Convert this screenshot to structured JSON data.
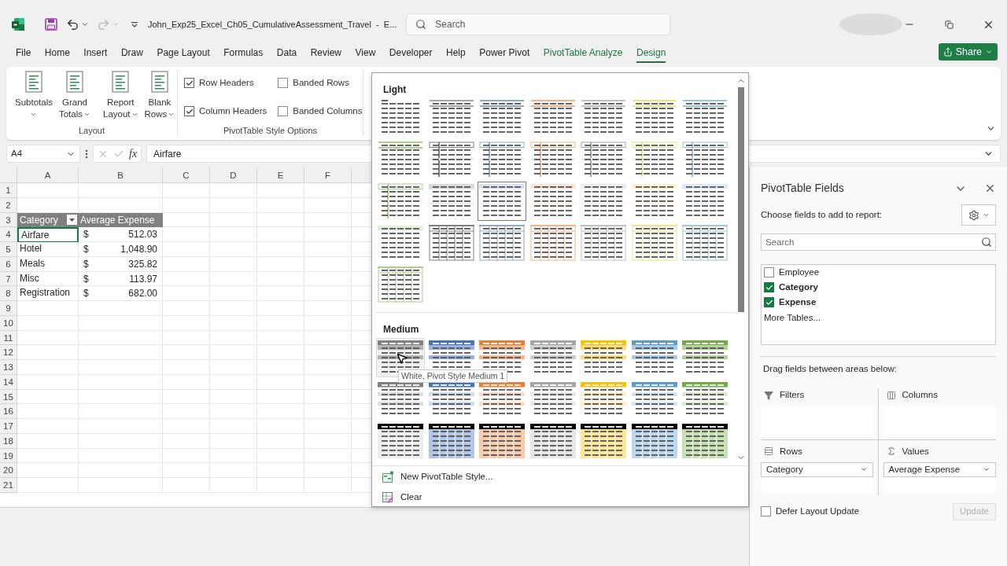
{
  "title_bar": {
    "title": "John_Exp25_Excel_Ch05_CumulativeAssessment_Travel  -  E...",
    "search": {
      "placeholder": "Search"
    },
    "share": "Share"
  },
  "menu_tabs": [
    {
      "label": "File",
      "contextual": false,
      "selected": false
    },
    {
      "label": "Home",
      "contextual": false,
      "selected": false
    },
    {
      "label": "Insert",
      "contextual": false,
      "selected": false
    },
    {
      "label": "Draw",
      "contextual": false,
      "selected": false
    },
    {
      "label": "Page Layout",
      "contextual": false,
      "selected": false
    },
    {
      "label": "Formulas",
      "contextual": false,
      "selected": false
    },
    {
      "label": "Data",
      "contextual": false,
      "selected": false
    },
    {
      "label": "Review",
      "contextual": false,
      "selected": false
    },
    {
      "label": "View",
      "contextual": false,
      "selected": false
    },
    {
      "label": "Developer",
      "contextual": false,
      "selected": false
    },
    {
      "label": "Help",
      "contextual": false,
      "selected": false
    },
    {
      "label": "Power Pivot",
      "contextual": false,
      "selected": false
    },
    {
      "label": "PivotTable Analyze",
      "contextual": true,
      "selected": false
    },
    {
      "label": "Design",
      "contextual": true,
      "selected": true
    }
  ],
  "ribbon": {
    "layout_group": {
      "label": "Layout",
      "buttons": [
        {
          "lines": [
            "Subtotals"
          ]
        },
        {
          "lines": [
            "Grand",
            "Totals"
          ]
        },
        {
          "lines": [
            "Report",
            "Layout"
          ]
        },
        {
          "lines": [
            "Blank",
            "Rows"
          ]
        }
      ]
    },
    "options_group": {
      "label": "PivotTable Style Options",
      "checkboxes": [
        {
          "label": "Row Headers",
          "checked": true
        },
        {
          "label": "Column Headers",
          "checked": true
        },
        {
          "label": "Banded Rows",
          "checked": false
        },
        {
          "label": "Banded Columns",
          "checked": false
        }
      ]
    }
  },
  "formula_bar": {
    "name_box": "A4",
    "fx": "fx",
    "value": "Airfare"
  },
  "sheet": {
    "columns": [
      "A",
      "B",
      "C",
      "D",
      "E",
      "F"
    ],
    "row_numbers": [
      "1",
      "2",
      "3",
      "4",
      "5",
      "6",
      "7",
      "8",
      "9",
      "10",
      "11",
      "12",
      "13",
      "14",
      "15",
      "16",
      "17",
      "18",
      "19",
      "20",
      "21"
    ],
    "pivot": {
      "header": [
        "Category",
        "Average Expense"
      ],
      "rows": [
        {
          "label": "Airfare",
          "currency": "$",
          "value": "512.03",
          "selected": true
        },
        {
          "label": "Hotel",
          "currency": "$",
          "value": "1,048.90",
          "selected": false
        },
        {
          "label": "Meals",
          "currency": "$",
          "value": "325.82",
          "selected": false
        },
        {
          "label": "Misc",
          "currency": "$",
          "value": "113.97",
          "selected": false
        },
        {
          "label": "Registration",
          "currency": "$",
          "value": "682.00",
          "selected": false
        }
      ]
    }
  },
  "style_gallery": {
    "sections": [
      {
        "title": "Light",
        "styles": [
          {
            "kind": "plain",
            "color": "#595959",
            "selected": false,
            "hovered": false
          },
          {
            "kind": "lines",
            "color": "#a6a6a6",
            "selected": false,
            "hovered": false
          },
          {
            "kind": "lines",
            "color": "#8ea9c1",
            "selected": false,
            "hovered": false
          },
          {
            "kind": "lines",
            "color": "#f4b183",
            "selected": false,
            "hovered": false
          },
          {
            "kind": "lines",
            "color": "#bfbfbf",
            "selected": false,
            "hovered": false
          },
          {
            "kind": "lines",
            "color": "#e6e67a",
            "selected": false,
            "hovered": false
          },
          {
            "kind": "lines",
            "color": "#9dc3d4",
            "selected": false,
            "hovered": false
          },
          {
            "kind": "lines",
            "color": "#a9d08e",
            "selected": false,
            "hovered": false
          },
          {
            "kind": "outline",
            "color": "#808080",
            "selected": false,
            "hovered": false
          },
          {
            "kind": "outline",
            "color": "#8ea9c1",
            "selected": false,
            "hovered": false
          },
          {
            "kind": "outline",
            "color": "#f4b183",
            "selected": false,
            "hovered": false
          },
          {
            "kind": "outline",
            "color": "#a6a6a6",
            "selected": false,
            "hovered": false
          },
          {
            "kind": "outline",
            "color": "#e6e67a",
            "selected": false,
            "hovered": false
          },
          {
            "kind": "outline",
            "color": "#9dc3d4",
            "selected": false,
            "hovered": false
          },
          {
            "kind": "outline",
            "color": "#a9d08e",
            "selected": false,
            "hovered": false
          },
          {
            "kind": "shaded",
            "color": "#d9d9d9",
            "selected": false,
            "hovered": false
          },
          {
            "kind": "shaded",
            "color": "#d9e1f2",
            "selected": true,
            "hovered": false
          },
          {
            "kind": "shaded",
            "color": "#fce4d6",
            "selected": false,
            "hovered": false
          },
          {
            "kind": "shaded",
            "color": "#ededed",
            "selected": false,
            "hovered": false
          },
          {
            "kind": "shaded",
            "color": "#fff2cc",
            "selected": false,
            "hovered": false
          },
          {
            "kind": "shaded",
            "color": "#ddebf7",
            "selected": false,
            "hovered": false
          },
          {
            "kind": "shaded",
            "color": "#e2efda",
            "selected": false,
            "hovered": false
          },
          {
            "kind": "grid",
            "color": "#808080",
            "selected": false,
            "hovered": false
          },
          {
            "kind": "grid",
            "color": "#8ea9c1",
            "selected": false,
            "hovered": false
          },
          {
            "kind": "grid",
            "color": "#f4b183",
            "selected": false,
            "hovered": false
          },
          {
            "kind": "grid",
            "color": "#bfbfbf",
            "selected": false,
            "hovered": false
          },
          {
            "kind": "grid",
            "color": "#e6e67a",
            "selected": false,
            "hovered": false
          },
          {
            "kind": "grid",
            "color": "#9dc3d4",
            "selected": false,
            "hovered": false
          },
          {
            "kind": "grid",
            "color": "#a9d08e",
            "selected": false,
            "hovered": false
          }
        ]
      },
      {
        "title": "Medium",
        "styles": [
          {
            "kind": "banded",
            "color": "#808080",
            "selected": false,
            "hovered": true
          },
          {
            "kind": "banded",
            "color": "#4472c4",
            "selected": false,
            "hovered": false
          },
          {
            "kind": "banded",
            "color": "#ed7d31",
            "selected": false,
            "hovered": false
          },
          {
            "kind": "banded",
            "color": "#a5a5a5",
            "selected": false,
            "hovered": false
          },
          {
            "kind": "banded",
            "color": "#ffc000",
            "selected": false,
            "hovered": false
          },
          {
            "kind": "banded",
            "color": "#5b9bd5",
            "selected": false,
            "hovered": false
          },
          {
            "kind": "banded",
            "color": "#70ad47",
            "selected": false,
            "hovered": false
          },
          {
            "kind": "header",
            "color": "#808080",
            "selected": false,
            "hovered": false
          },
          {
            "kind": "header",
            "color": "#4472c4",
            "selected": false,
            "hovered": false
          },
          {
            "kind": "header",
            "color": "#ed7d31",
            "selected": false,
            "hovered": false
          },
          {
            "kind": "header",
            "color": "#a5a5a5",
            "selected": false,
            "hovered": false
          },
          {
            "kind": "header",
            "color": "#ffc000",
            "selected": false,
            "hovered": false
          },
          {
            "kind": "header",
            "color": "#5b9bd5",
            "selected": false,
            "hovered": false
          },
          {
            "kind": "header",
            "color": "#70ad47",
            "selected": false,
            "hovered": false
          },
          {
            "kind": "dark",
            "color": "#ededed",
            "selected": false,
            "hovered": false
          },
          {
            "kind": "dark",
            "color": "#b4c6e7",
            "selected": false,
            "hovered": false
          },
          {
            "kind": "dark",
            "color": "#f8cbad",
            "selected": false,
            "hovered": false
          },
          {
            "kind": "dark",
            "color": "#e7e6e6",
            "selected": false,
            "hovered": false
          },
          {
            "kind": "dark",
            "color": "#ffe699",
            "selected": false,
            "hovered": false
          },
          {
            "kind": "dark",
            "color": "#bdd7ee",
            "selected": false,
            "hovered": false
          },
          {
            "kind": "dark",
            "color": "#c6e0b4",
            "selected": false,
            "hovered": false
          }
        ]
      }
    ],
    "tooltip": "White, Pivot Style Medium 1",
    "actions": [
      {
        "kind": "new",
        "label": "New PivotTable Style..."
      },
      {
        "kind": "clear",
        "label": "Clear"
      }
    ]
  },
  "fields_pane": {
    "title": "PivotTable Fields",
    "subtitle": "Choose fields to add to report:",
    "search": {
      "placeholder": "Search"
    },
    "fields": [
      {
        "label": "Employee",
        "checked": false
      },
      {
        "label": "Category",
        "checked": true
      },
      {
        "label": "Expense",
        "checked": true
      }
    ],
    "more_tables": "More Tables...",
    "areas_hint": "Drag fields between areas below:",
    "areas": [
      {
        "kind": "filters",
        "label": "Filters"
      },
      {
        "kind": "columns",
        "label": "Columns"
      },
      {
        "kind": "rows",
        "label": "Rows",
        "item": "Category"
      },
      {
        "kind": "values",
        "label": "Values",
        "item": "Average Expense"
      }
    ],
    "defer": {
      "label": "Defer Layout Update",
      "checked": false
    },
    "update": "Update"
  }
}
